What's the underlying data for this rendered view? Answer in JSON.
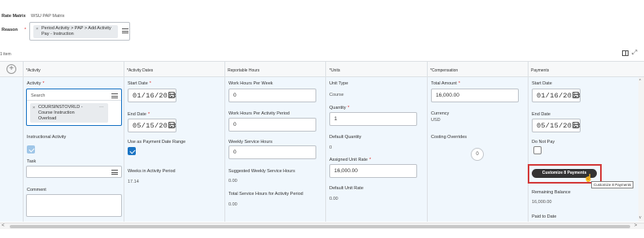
{
  "header": {
    "rate_matrix_label": "Rate Matrix",
    "rate_matrix_value": "WSU PAP Matrix",
    "reason_label": "Reason",
    "reason_chip": "Period Activity > PAP > Add Activity Pay - Instruction"
  },
  "table": {
    "item_count": "1 item",
    "columns": [
      "*Activity",
      "*Activity Dates",
      "Reportable Hours",
      "*Units",
      "*Compensation",
      "Payments"
    ]
  },
  "activity": {
    "label": "Activity",
    "search_placeholder": "Search",
    "chip": "COURSINSTOVRLD - Course Instruction Overload",
    "instructional_activity_label": "Instructional Activity",
    "instructional_activity_checked": true,
    "task_label": "Task",
    "comment_label": "Comment"
  },
  "dates": {
    "start_label": "Start Date",
    "start_value": "01/16/2023",
    "end_label": "End Date",
    "end_value": "05/15/2023",
    "use_payment_label": "Use as Payment Date Range",
    "use_payment_checked": true,
    "weeks_label": "Weeks in Activity Period",
    "weeks_value": "17.14"
  },
  "hours": {
    "work_per_week_label": "Work Hours Per Week",
    "work_per_week_value": "0",
    "work_per_period_label": "Work Hours Per Activity Period",
    "work_per_period_value": "0",
    "weekly_service_label": "Weekly Service Hours",
    "weekly_service_value": "0",
    "suggested_label": "Suggested Weekly Service Hours",
    "suggested_value": "0.00",
    "total_service_label": "Total Service Hours for Activity Period",
    "total_service_value": "0.00"
  },
  "units": {
    "unit_type_label": "Unit Type",
    "unit_type_value": "Course",
    "quantity_label": "Quantity",
    "quantity_value": "1",
    "default_quantity_label": "Default Quantity",
    "default_quantity_value": "0",
    "assigned_rate_label": "Assigned Unit Rate",
    "assigned_rate_value": "16,000.00",
    "default_rate_label": "Default Unit Rate",
    "default_rate_value": "0.00"
  },
  "compensation": {
    "total_amount_label": "Total Amount",
    "total_amount_value": "16,000.00",
    "currency_label": "Currency",
    "currency_value": "USD",
    "costing_label": "Costing Overrides",
    "costing_count": "0"
  },
  "payments": {
    "start_label": "Start Date",
    "start_value": "01/16/2023",
    "end_label": "End Date",
    "end_value": "05/15/2023",
    "do_not_pay_label": "Do Not Pay",
    "customize_button": "Customize 8 Payments",
    "tooltip": "Customize 8 Payments",
    "remaining_label": "Remaining Balance",
    "remaining_value": "16,000.00",
    "paid_label": "Paid to Date"
  },
  "colors": {
    "accent": "#1a74c4",
    "required": "#dd2222",
    "highlight_box": "#d33b3b",
    "button_bg": "#333333",
    "row_bg": "#f0f7fd"
  }
}
